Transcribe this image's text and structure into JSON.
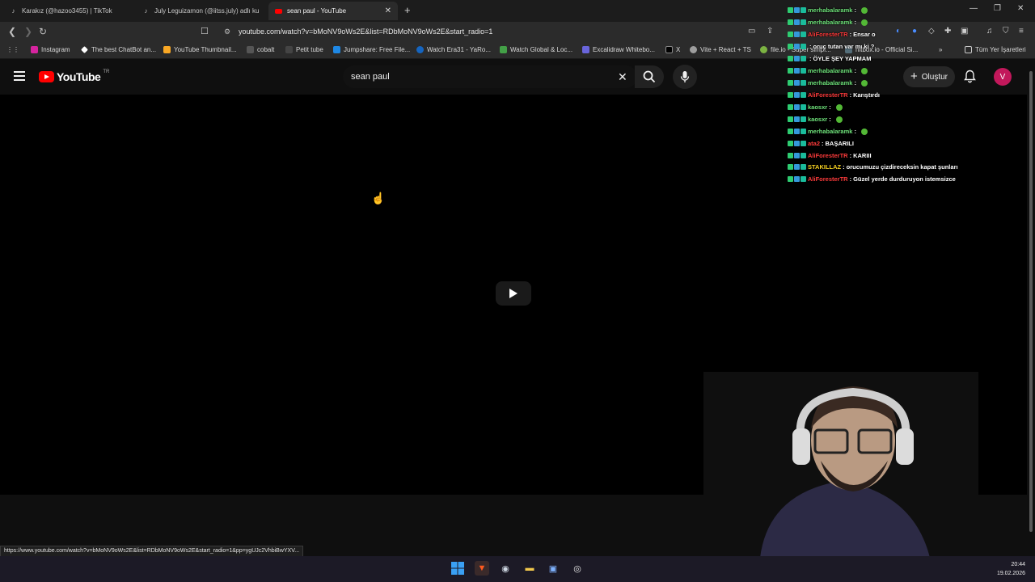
{
  "browser": {
    "tabs": [
      {
        "title": "Karakız (@hazoo3455) | TikTok"
      },
      {
        "title": "July Leguizamon (@iitss.july) adlı kull"
      },
      {
        "title": "sean paul - YouTube",
        "active": true
      }
    ],
    "url": "youtube.com/watch?v=bMoNV9oWs2E&list=RDbMoNV9oWs2E&start_radio=1",
    "bookmarks": [
      {
        "label": "Instagram",
        "color": "#d6249f"
      },
      {
        "label": "The best ChatBot an...",
        "color": "#ffffff"
      },
      {
        "label": "YouTube Thumbnail...",
        "color": "#f9a825"
      },
      {
        "label": "cobalt",
        "color": "#dddddd"
      },
      {
        "label": "Petit tube",
        "color": "#444444"
      },
      {
        "label": "Jumpshare: Free File...",
        "color": "#1e88e5"
      },
      {
        "label": "Watch Era31 - YaRo...",
        "color": "#1565c0"
      },
      {
        "label": "Watch Global & Loc...",
        "color": "#43a047"
      },
      {
        "label": "Excalidraw Whitebo...",
        "color": "#6965db"
      },
      {
        "label": "X",
        "color": "#000000"
      },
      {
        "label": "Vite + React + TS",
        "color": "#9e9e9e"
      },
      {
        "label": "file.io - Super simpl...",
        "color": "#7cb342"
      },
      {
        "label": "hitbox.io - Official Si...",
        "color": "#546e7a"
      }
    ],
    "all_bookmarks_label": "Tüm Yer İşaretleri",
    "status_url": "https://www.youtube.com/watch?v=bMoNV9oWs2E&list=RDbMoNV9oWs2E&start_radio=1&pp=ygUJc2VhbiBwYXV..."
  },
  "youtube": {
    "logo_text": "YouTube",
    "region": "TR",
    "search_value": "sean paul",
    "create_label": "Oluştur",
    "avatar_letter": "V"
  },
  "chat": [
    {
      "user": "merhabalaramk",
      "color": "#6ee27a",
      "msg": "",
      "emote": true
    },
    {
      "user": "merhabalaramk",
      "color": "#6ee27a",
      "msg": "",
      "emote": true
    },
    {
      "user": "AliForesterTR",
      "color": "#ff3b3b",
      "msg": "Ensar o",
      "emote": false
    },
    {
      "user": "",
      "color": "#ff3b3b",
      "msg": "oruç tutan var mı ki ?",
      "emote": false
    },
    {
      "user": "",
      "color": "#ff3b3b",
      "msg": "ÖYLE ŞEY YAPMAM",
      "emote": false
    },
    {
      "user": "merhabalaramk",
      "color": "#6ee27a",
      "msg": "",
      "emote": true
    },
    {
      "user": "merhabalaramk",
      "color": "#6ee27a",
      "msg": "",
      "emote": true
    },
    {
      "user": "AliForesterTR",
      "color": "#ff3b3b",
      "msg": "Karıştırdı",
      "emote": false
    },
    {
      "user": "kaosxr",
      "color": "#6ee27a",
      "msg": "",
      "emote": true
    },
    {
      "user": "kaosxr",
      "color": "#6ee27a",
      "msg": "",
      "emote": true
    },
    {
      "user": "merhabalaramk",
      "color": "#6ee27a",
      "msg": "",
      "emote": true
    },
    {
      "user": "ata2",
      "color": "#ff3b3b",
      "msg": "BAŞARILI",
      "emote": false
    },
    {
      "user": "AliForesterTR",
      "color": "#ff3b3b",
      "msg": "KARIII",
      "emote": false
    },
    {
      "user": "STAKILLAZ",
      "color": "#f5d020",
      "msg": "orucumuzu çizdireceksin kapat şunları",
      "emote": false
    },
    {
      "user": "AliForesterTR",
      "color": "#ff3b3b",
      "msg": "Güzel yerde durduruyon istemsizce",
      "emote": false
    }
  ],
  "taskbar": {
    "time": "20:44",
    "date": "19.02.2026"
  }
}
